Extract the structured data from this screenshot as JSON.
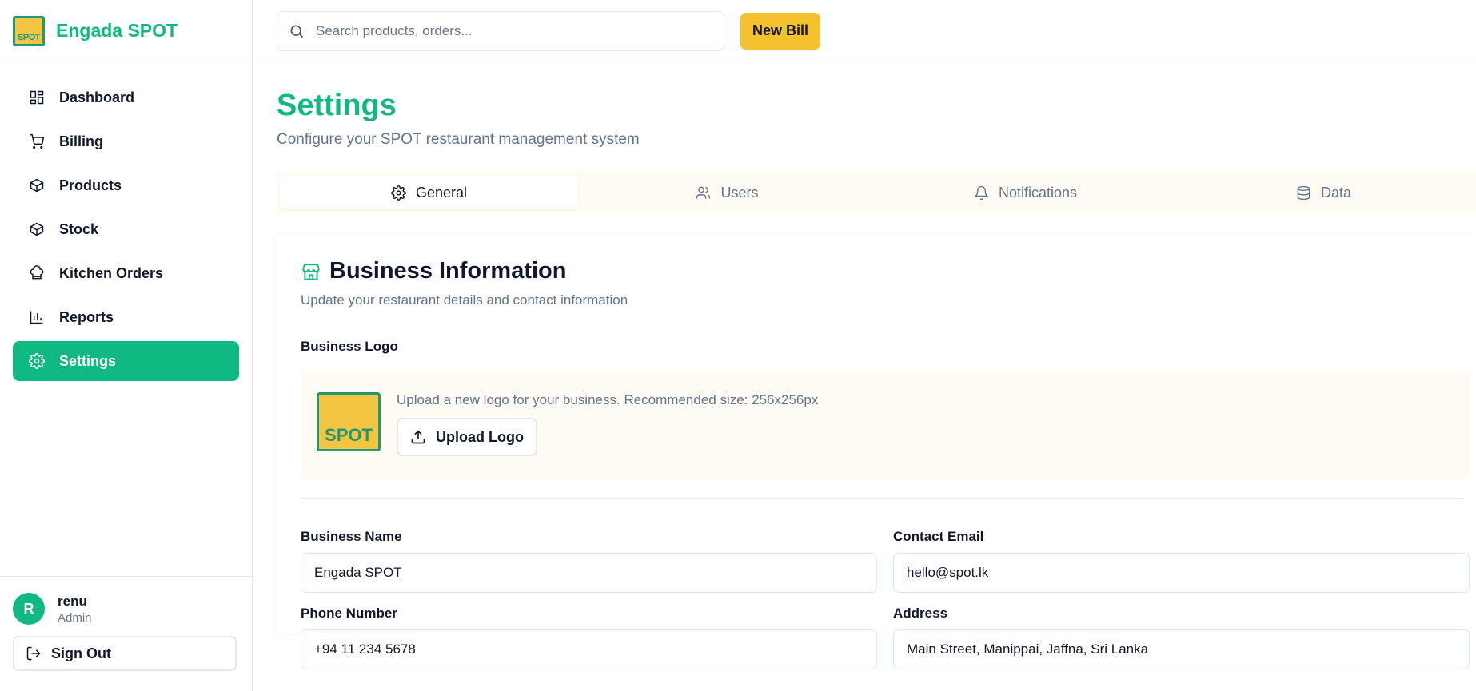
{
  "brand": {
    "name": "Engada SPOT",
    "logo_text": "SPOT"
  },
  "sidebar": {
    "items": [
      {
        "label": "Dashboard",
        "icon": "dashboard-icon"
      },
      {
        "label": "Billing",
        "icon": "cart-icon"
      },
      {
        "label": "Products",
        "icon": "package-icon"
      },
      {
        "label": "Stock",
        "icon": "package-icon"
      },
      {
        "label": "Kitchen Orders",
        "icon": "chef-hat-icon"
      },
      {
        "label": "Reports",
        "icon": "bar-chart-icon"
      },
      {
        "label": "Settings",
        "icon": "gear-icon",
        "active": true
      }
    ],
    "user": {
      "initial": "R",
      "name": "renu",
      "role": "Admin"
    },
    "signout_label": "Sign Out"
  },
  "header": {
    "search_placeholder": "Search products, orders...",
    "new_bill_label": "New Bill"
  },
  "page": {
    "title": "Settings",
    "subtitle": "Configure your SPOT restaurant management system"
  },
  "tabs": [
    {
      "label": "General",
      "icon": "gear-icon",
      "active": true
    },
    {
      "label": "Users",
      "icon": "users-icon"
    },
    {
      "label": "Notifications",
      "icon": "bell-icon"
    },
    {
      "label": "Data",
      "icon": "database-icon"
    }
  ],
  "business": {
    "title": "Business Information",
    "subtitle": "Update your restaurant details and contact information",
    "logo_label": "Business Logo",
    "logo_text": "SPOT",
    "logo_help": "Upload a new logo for your business. Recommended size: 256x256px",
    "upload_label": "Upload Logo",
    "fields": {
      "name": {
        "label": "Business Name",
        "value": "Engada SPOT"
      },
      "email": {
        "label": "Contact Email",
        "value": "hello@spot.lk"
      },
      "phone": {
        "label": "Phone Number",
        "value": "+94 11 234 5678"
      },
      "address": {
        "label": "Address",
        "value": "Main Street, Manippai, Jaffna, Sri Lanka"
      }
    }
  },
  "colors": {
    "accent": "#10b981",
    "button_yellow": "#f6c12f",
    "tab_bg": "#fefbf3"
  }
}
